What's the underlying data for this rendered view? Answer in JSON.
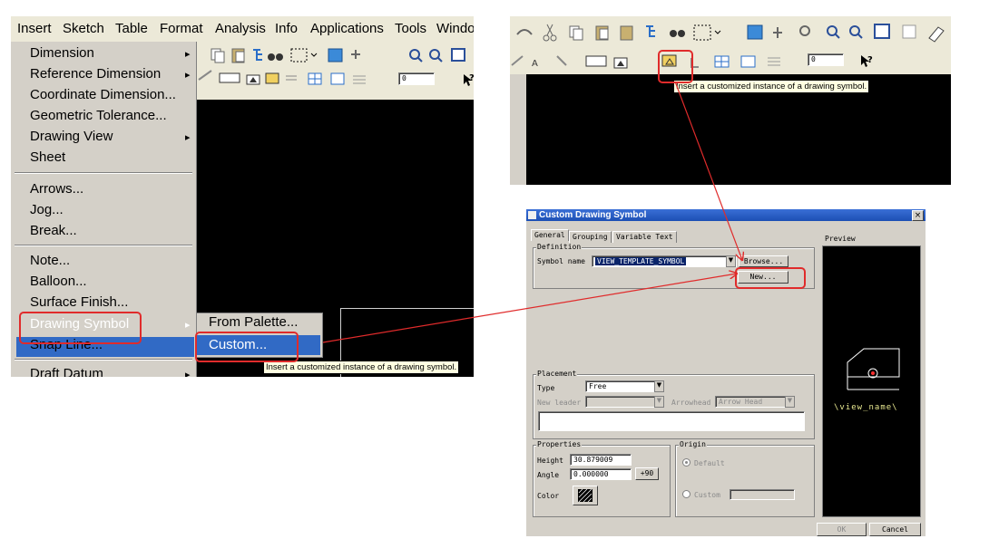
{
  "panel1": {
    "menubar": [
      "Insert",
      "Sketch",
      "Table",
      "Format",
      "Analysis",
      "Info",
      "Applications",
      "Tools",
      "Windo"
    ],
    "menu_items": [
      {
        "label": "Dimension",
        "submenu": true
      },
      {
        "label": "Reference Dimension",
        "submenu": true
      },
      {
        "label": "Coordinate Dimension...",
        "submenu": false
      },
      {
        "label": "Geometric Tolerance...",
        "submenu": false
      },
      {
        "label": "Drawing View",
        "submenu": true
      },
      {
        "label": "Sheet",
        "submenu": false
      },
      {
        "label": "Arrows...",
        "submenu": false
      },
      {
        "label": "Jog...",
        "submenu": false
      },
      {
        "label": "Break...",
        "submenu": false
      },
      {
        "label": "Note...",
        "submenu": false
      },
      {
        "label": "Balloon...",
        "submenu": false
      },
      {
        "label": "Surface Finish...",
        "submenu": false
      },
      {
        "label": "Drawing Symbol",
        "submenu": true
      },
      {
        "label": "Snap Line...",
        "submenu": false
      },
      {
        "label": "Draft Datum",
        "submenu": true
      }
    ],
    "submenu_items": [
      "From Palette...",
      "Custom..."
    ],
    "spinner_value": "0",
    "tooltip": "Insert a customized instance of a drawing symbol."
  },
  "panel2": {
    "spinner_value": "0",
    "tooltip": "Insert a customized instance of a drawing symbol."
  },
  "dialog": {
    "title": "Custom Drawing Symbol",
    "close_label": "×",
    "tabs": [
      "General",
      "Grouping",
      "Variable Text"
    ],
    "definition": {
      "group_label": "Definition",
      "symbol_name_label": "Symbol name",
      "symbol_name_value": "VIEW_TEMPLATE_SYMBOL",
      "browse_label": "Browse...",
      "new_label": "New..."
    },
    "preview": {
      "group_label": "Preview",
      "symbol_text": "\\view_name\\"
    },
    "placement": {
      "group_label": "Placement",
      "type_label": "Type",
      "type_value": "Free",
      "new_leader_label": "New leader",
      "arrowhead_label": "Arrowhead",
      "arrowhead_value": "Arrow Head"
    },
    "properties": {
      "group_label": "Properties",
      "height_label": "Height",
      "height_value": "30.879009",
      "angle_label": "Angle",
      "angle_value": "0.000000",
      "plus90_label": "+90",
      "color_label": "Color"
    },
    "origin": {
      "group_label": "Origin",
      "default_label": "Default",
      "custom_label": "Custom"
    },
    "ok_label": "OK",
    "cancel_label": "Cancel"
  },
  "colors": {
    "highlight": "#316ac5",
    "annotation_red": "#e02b2b",
    "tooltip_bg": "#ffffe1",
    "canvas": "#000000",
    "dialog_bg": "#d4d0c8"
  }
}
